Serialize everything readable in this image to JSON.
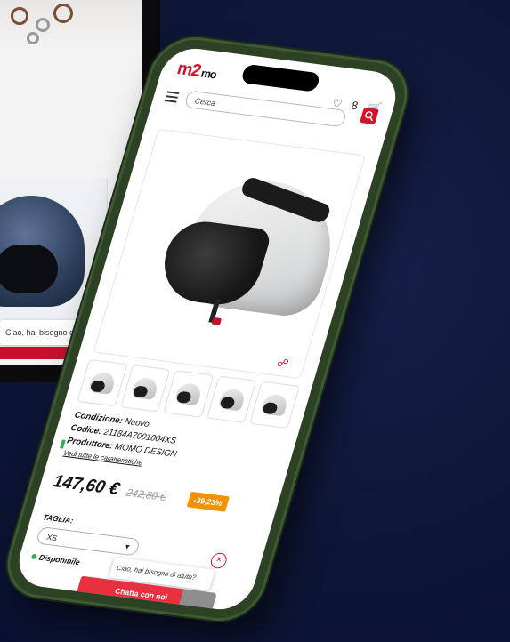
{
  "background_window": {
    "chat_text": "Ciao, hai bisogno di aiuto?"
  },
  "header": {
    "logo_text": "m2",
    "logo_rest": "mo",
    "search_placeholder": "Cerca",
    "top_icons": "♡ 8 🛒"
  },
  "product": {
    "condition_label": "Condizione:",
    "condition_value": "Nuovo",
    "code_label": "Codice:",
    "code_value": "21184A7001004XS",
    "producer_label": "Produttore:",
    "producer_value": "MOMO DESIGN",
    "features_link": "Vedi tutte le caratteristiche",
    "price": "147,60 €",
    "old_price": "242,80 €",
    "discount": "-39,23%",
    "size_label": "TAGLIA:",
    "size_value": "XS",
    "availability": "Disponibile"
  },
  "chat": {
    "bubble_text": "Ciao, hai bisogno di aiuto?",
    "button_label": "Chatta con noi"
  },
  "colors": {
    "brand_red": "#d2152b",
    "discount_orange": "#f39200",
    "available_green": "#2bb24c",
    "phone_green": "#2d4225",
    "background_navy": "#0e1636"
  }
}
